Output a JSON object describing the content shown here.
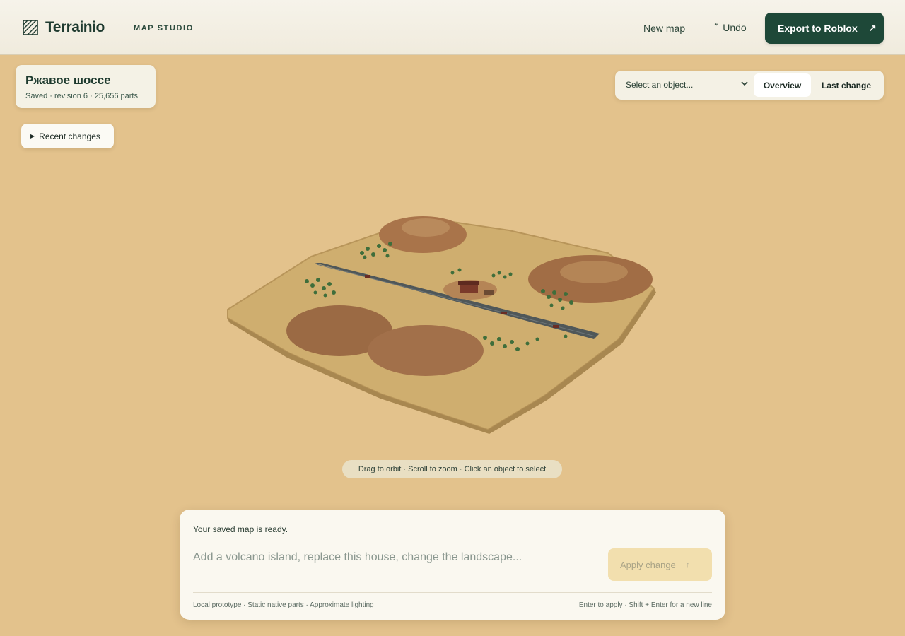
{
  "header": {
    "brand_name": "Terrainio",
    "brand_subtitle": "MAP STUDIO",
    "new_map_label": "New map",
    "undo_label": "Undo",
    "export_label": "Export to Roblox"
  },
  "map": {
    "title": "Ржавое шоссе",
    "meta": "Saved · revision 6 · 25,656 parts"
  },
  "recent_changes_label": "Recent changes",
  "view": {
    "select_placeholder": "Select an object...",
    "overview_label": "Overview",
    "last_change_label": "Last change",
    "active": "Overview"
  },
  "viewport_hint": "Drag to orbit · Scroll to zoom · Click an object to select",
  "composer": {
    "status": "Your saved map is ready.",
    "placeholder": "Add a volcano island, replace this house, change the landscape...",
    "apply_label": "Apply change",
    "footer_left": "Local prototype · Static native parts · Approximate lighting",
    "footer_right": "Enter to apply · Shift + Enter for a new line"
  },
  "colors": {
    "background": "#e3c28c",
    "accent": "#1e4838",
    "terrain": "#cfae6f",
    "hill": "#a9744a",
    "road": "#4f5759"
  },
  "icons": [
    "logo-icon",
    "undo-icon",
    "external-arrow-icon",
    "triangle-right-icon",
    "chevron-down-icon",
    "arrow-up-icon"
  ]
}
